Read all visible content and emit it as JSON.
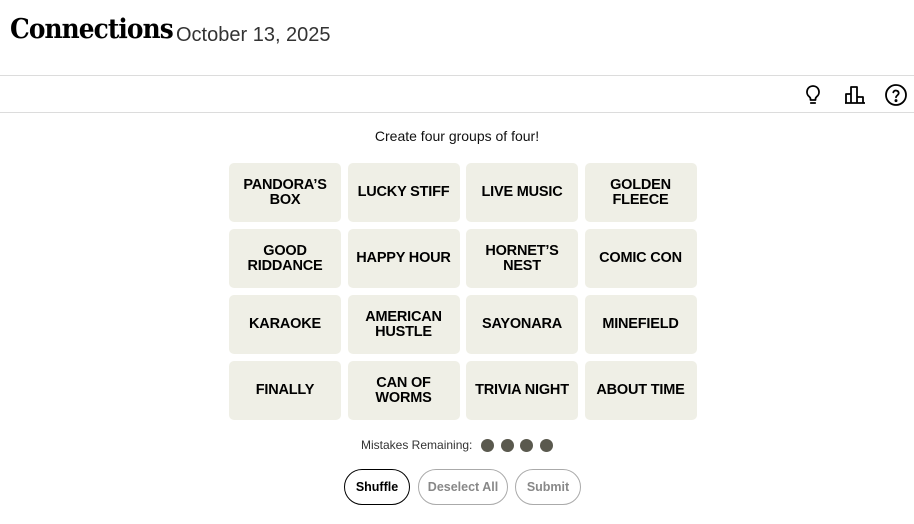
{
  "header": {
    "title": "Connections",
    "date": "October 13, 2025"
  },
  "toolbar": {
    "icons": [
      "lightbulb-icon",
      "leaderboard-icon",
      "help-icon"
    ]
  },
  "game": {
    "prompt": "Create four groups of four!",
    "tiles": [
      "PANDORA’S BOX",
      "LUCKY STIFF",
      "LIVE MUSIC",
      "GOLDEN\nFLEECE",
      "GOOD\nRIDDANCE",
      "HAPPY HOUR",
      "HORNET’S NEST",
      "COMIC CON",
      "KARAOKE",
      "AMERICAN\nHUSTLE",
      "SAYONARA",
      "MINEFIELD",
      "FINALLY",
      "CAN OF WORMS",
      "TRIVIA NIGHT",
      "ABOUT TIME"
    ],
    "mistakes_label": "Mistakes Remaining:",
    "mistakes_remaining": 4
  },
  "buttons": {
    "shuffle": "Shuffle",
    "deselect_all": "Deselect All",
    "submit": "Submit"
  },
  "colors": {
    "tile_bg": "#efefe6",
    "dot": "#5a594e"
  }
}
